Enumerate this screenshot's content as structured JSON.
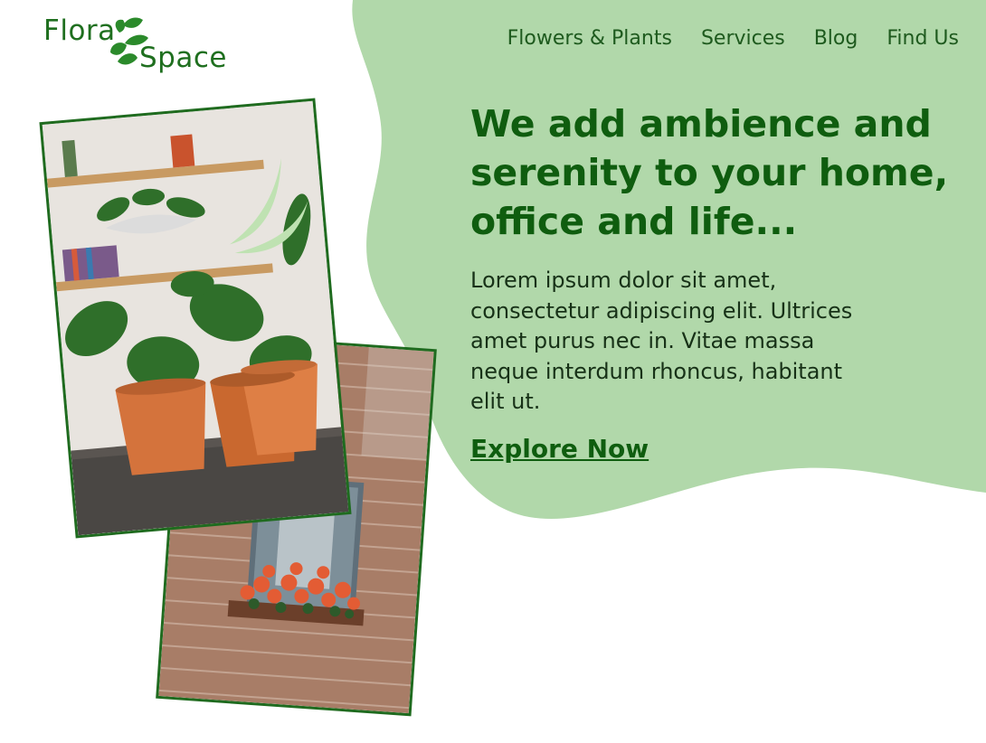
{
  "brand": {
    "line1": "Flora",
    "line2": "Space",
    "icon": "leaf-icon"
  },
  "nav": {
    "items": [
      {
        "label": "Flowers & Plants"
      },
      {
        "label": "Services"
      },
      {
        "label": "Blog"
      },
      {
        "label": "Find Us"
      }
    ]
  },
  "hero": {
    "headline": "We add ambience and serenity to your home, office and life...",
    "body": "Lorem ipsum dolor sit amet, consectetur adipiscing elit. Ultrices amet purus nec in. Vitae massa neque interdum rhoncus, habitant elit ut.",
    "cta_label": "Explore Now"
  },
  "colors": {
    "accent_blob": "#b1d8aa",
    "brand_green": "#1f6f1f",
    "headline_green": "#0f5d0f",
    "body_text": "#173117"
  },
  "images": {
    "front_photo": "potted-plants-shelf-photo",
    "back_photo": "brick-wall-flower-window-photo"
  }
}
